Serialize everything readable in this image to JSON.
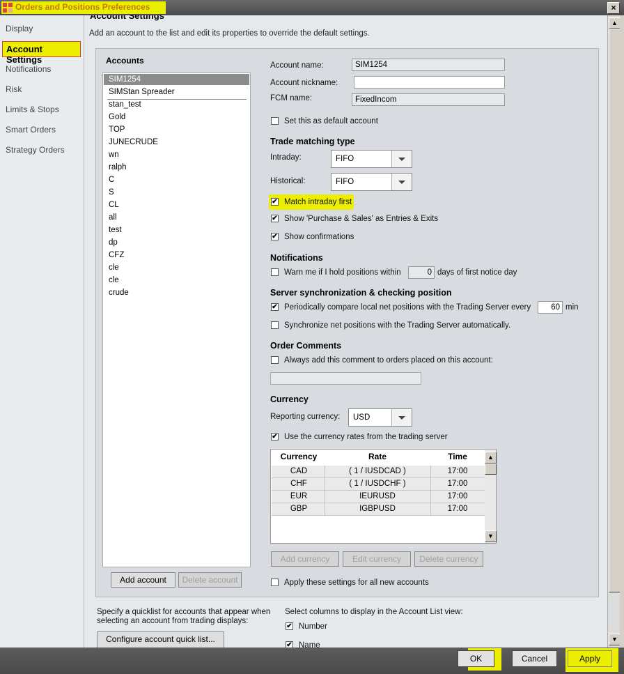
{
  "window": {
    "title": "Orders and Positions Preferences",
    "close_glyph": "×"
  },
  "nav": {
    "items": [
      "Display",
      "Account Settings",
      "Notifications",
      "Risk",
      "Limits & Stops",
      "Smart Orders",
      "Strategy Orders"
    ],
    "active": "Account Settings"
  },
  "page": {
    "section_title": "Account Settings",
    "intro": "Add an account to the list and edit its properties to override the default settings."
  },
  "accounts": {
    "heading": "Accounts",
    "list": [
      "SIM1254",
      "SIMStan Spreader",
      "stan_test",
      "Gold",
      "TOP",
      "JUNECRUDE",
      "wn",
      "ralph",
      "C",
      "S",
      "CL",
      "all",
      "test",
      "dp",
      "CFZ",
      "cle",
      "cle",
      "crude"
    ],
    "selected": "SIM1254",
    "add_label": "Add account",
    "delete_label": "Delete account"
  },
  "details": {
    "account_name_label": "Account name:",
    "account_name_value": "SIM1254",
    "nickname_label": "Account nickname:",
    "nickname_value": "",
    "fcm_label": "FCM name:",
    "fcm_value": "FixedIncom",
    "default_label": "Set this as default account",
    "trade_heading": "Trade matching type",
    "intraday_label": "Intraday:",
    "intraday_value": "FIFO",
    "historical_label": "Historical:",
    "historical_value": "FIFO",
    "match_intraday_label": "Match intraday first",
    "show_purchase_label": "Show 'Purchase & Sales' as Entries & Exits",
    "show_confirm_label": "Show confirmations",
    "notif_heading": "Notifications",
    "warn_label_a": "Warn me if I hold positions within",
    "warn_days": "0",
    "warn_label_b": "days of first notice day",
    "server_heading": "Server synchronization & checking position",
    "periodic_label": "Periodically compare local net positions with the Trading Server every",
    "periodic_value": "60",
    "periodic_unit": "min",
    "sync_label": "Synchronize net positions with the Trading Server automatically.",
    "comments_heading": "Order Comments",
    "comments_label": "Always add this comment to orders placed on this account:",
    "comment_value": "",
    "currency_heading": "Currency",
    "reporting_label": "Reporting currency:",
    "reporting_value": "USD",
    "use_rates_label": "Use the currency rates from the trading server",
    "table": {
      "headers": [
        "Currency",
        "Rate",
        "Time"
      ],
      "rows": [
        [
          "CAD",
          "( 1 / IUSDCAD )",
          "17:00"
        ],
        [
          "CHF",
          "( 1 / IUSDCHF )",
          "17:00"
        ],
        [
          "EUR",
          "IEURUSD",
          "17:00"
        ],
        [
          "GBP",
          "IGBPUSD",
          "17:00"
        ]
      ]
    },
    "add_currency": "Add currency",
    "edit_currency": "Edit currency",
    "delete_currency": "Delete currency",
    "apply_new_label": "Apply these settings for all new accounts"
  },
  "quicklist": {
    "text": [
      "Specify a quicklist for accounts that appear when",
      "selecting an account from trading displays:"
    ],
    "button": "Configure account quick list..."
  },
  "columns": {
    "text": "Select columns to display in the Account List view:",
    "items": [
      "Number",
      "Name"
    ]
  },
  "footer": {
    "ok": "OK",
    "cancel": "Cancel",
    "apply": "Apply"
  },
  "colors": {
    "highlight": "#ecf000",
    "title_text": "#c87800"
  },
  "glyphs": {
    "check": "✔",
    "up": "▲",
    "down": "▼"
  }
}
